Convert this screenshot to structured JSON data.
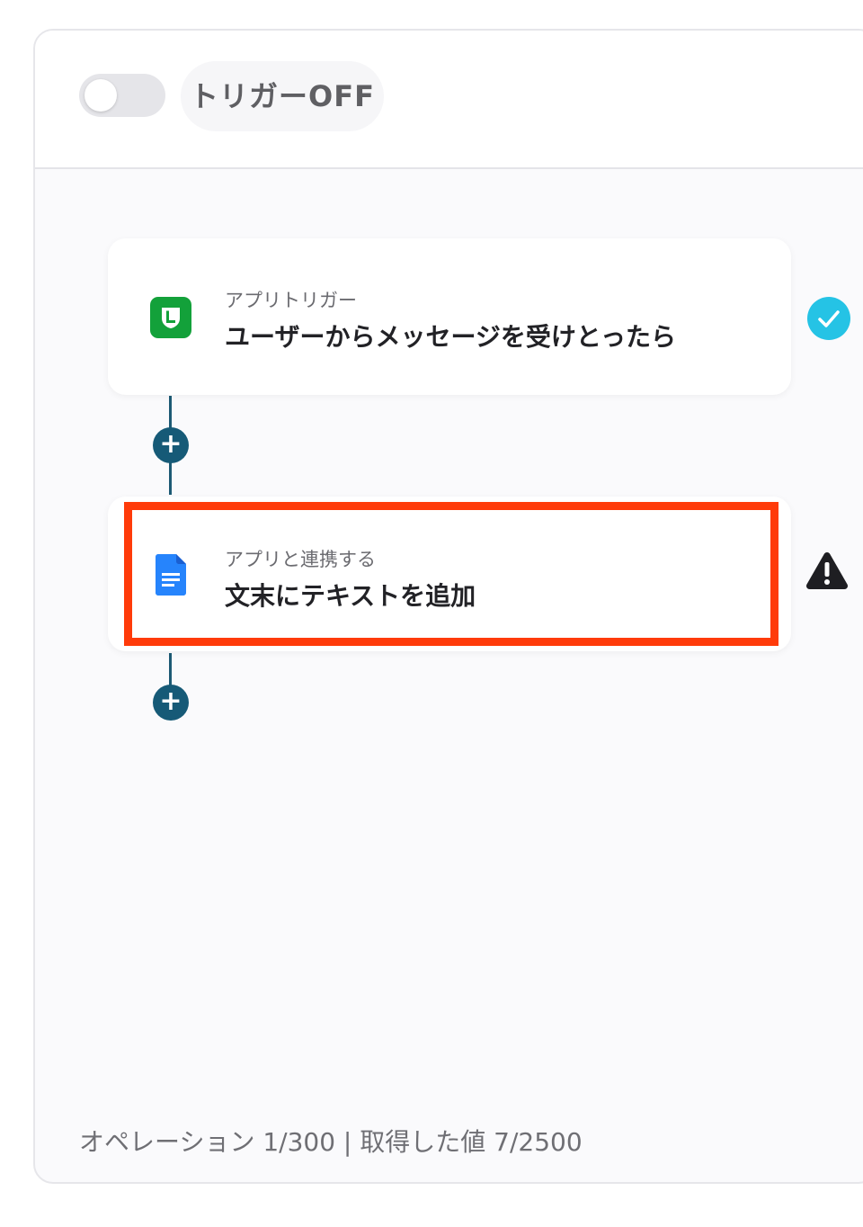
{
  "trigger_toggle": {
    "label": "トリガーOFF",
    "state": "off"
  },
  "steps": [
    {
      "subtitle": "アプリトリガー",
      "title": "ユーザーからメッセージを受けとったら",
      "app_icon": "line-icon",
      "status": "check-icon"
    },
    {
      "subtitle": "アプリと連携する",
      "title": "文末にテキストを追加",
      "app_icon": "google-docs-icon",
      "status": "warning-icon"
    }
  ],
  "add_step_symbol": "+",
  "footer": {
    "text": "オペレーション 1/300 | 取得した値 7/2500"
  },
  "colors": {
    "connector": "#1c5a74",
    "highlight": "#ff3b0a",
    "check": "#25c3e5",
    "line_green": "#13a13a",
    "docs_blue": "#2684fc"
  }
}
